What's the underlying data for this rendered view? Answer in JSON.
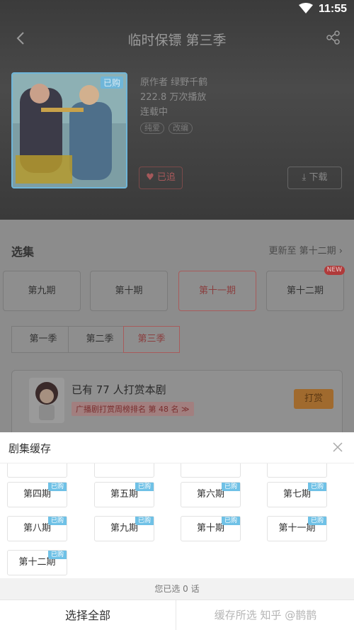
{
  "status": {
    "time": "11:55"
  },
  "header": {
    "title": "临时保镖 第三季"
  },
  "cover": {
    "badge": "已购"
  },
  "meta": {
    "author_line": "原作者 绿野千鹤",
    "plays": "222.8 万次播放",
    "status": "连载中",
    "tags": [
      "纯爱",
      "改编"
    ]
  },
  "actions": {
    "followed": "已追",
    "download": "下载"
  },
  "episodes_section": {
    "title": "选集",
    "update": "更新至 第十二期",
    "episodes": [
      {
        "label": "第九期"
      },
      {
        "label": "第十期"
      },
      {
        "label": "第十一期"
      },
      {
        "label": "第十二期",
        "badge": "NEW"
      }
    ],
    "seasons": [
      "第一季",
      "第二季",
      "第三季"
    ]
  },
  "reward": {
    "text": "已有 77 人打赏本剧",
    "rank": "广播剧打赏周榜排名 第 48 名 ≫",
    "button": "打赏"
  },
  "sheet": {
    "title": "剧集缓存",
    "bought_label": "已购",
    "rows": [
      [
        "第四期",
        "第五期",
        "第六期",
        "第七期"
      ],
      [
        "第八期",
        "第九期",
        "第十期",
        "第十一期"
      ],
      [
        "第十二期"
      ]
    ],
    "selected_count": "您已选 0 话",
    "select_all": "选择全部",
    "cache_selected": "缓存所选"
  },
  "watermark": "知乎 @鹊鹊",
  "colors": {
    "accent": "#6fc1e6",
    "reward": "#e08a2a",
    "selected": "#e04b4b"
  }
}
